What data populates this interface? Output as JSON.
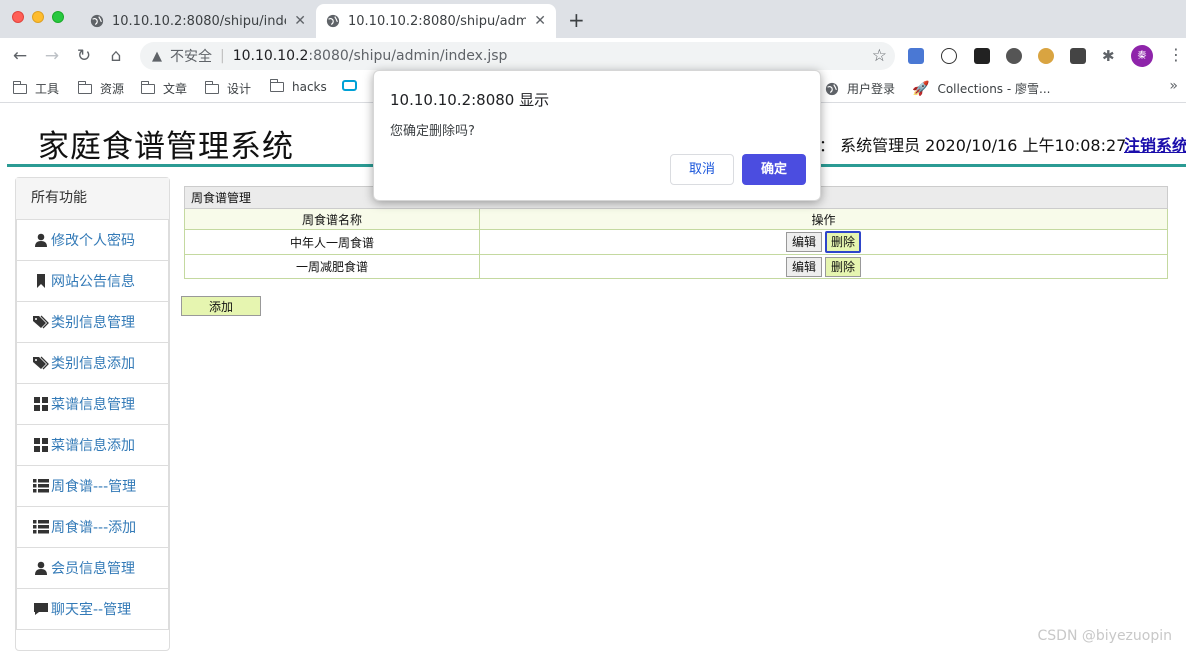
{
  "browser": {
    "tabs": [
      {
        "title": "10.10.10.2:8080/shipu/index#",
        "active": false
      },
      {
        "title": "10.10.10.2:8080/shipu/admin/in",
        "active": true
      }
    ],
    "address": {
      "security_label": "不安全",
      "host": "10.10.10.2",
      "path": ":8080/shipu/admin/index.jsp"
    },
    "profile_initial": "秦",
    "bookmarks": [
      {
        "label": "工具",
        "icon": "folder-icon"
      },
      {
        "label": "资源",
        "icon": "folder-icon"
      },
      {
        "label": "文章",
        "icon": "folder-icon"
      },
      {
        "label": "设计",
        "icon": "folder-icon"
      },
      {
        "label": "hacks",
        "icon": "folder-icon"
      },
      {
        "label": "用户登录",
        "icon": "globe-icon"
      },
      {
        "label": "Collections - 廖雪...",
        "icon": "rocket-icon"
      }
    ]
  },
  "header": {
    "site_title": "家庭食谱管理系统",
    "user_info": "：  系统管理员  2020/10/16 上午10:08:27",
    "logout_label": "注销系统"
  },
  "sidebar": {
    "heading": "所有功能",
    "items": [
      {
        "label": "修改个人密码",
        "icon": "user-icon"
      },
      {
        "label": "网站公告信息",
        "icon": "bookmark-icon"
      },
      {
        "label": "类别信息管理",
        "icon": "tags-icon"
      },
      {
        "label": "类别信息添加",
        "icon": "tags-icon"
      },
      {
        "label": "菜谱信息管理",
        "icon": "grid-icon"
      },
      {
        "label": "菜谱信息添加",
        "icon": "grid-icon"
      },
      {
        "label": "周食谱---管理",
        "icon": "list-icon"
      },
      {
        "label": "周食谱---添加",
        "icon": "list-icon"
      },
      {
        "label": "会员信息管理",
        "icon": "user-icon"
      },
      {
        "label": "聊天室--管理",
        "icon": "comment-icon"
      }
    ]
  },
  "table": {
    "caption": "周食谱管理",
    "headers": [
      "周食谱名称",
      "操作"
    ],
    "rows": [
      {
        "name": "中年人一周食谱",
        "edit": "编辑",
        "delete": "删除"
      },
      {
        "name": "一周减肥食谱",
        "edit": "编辑",
        "delete": "删除"
      }
    ],
    "add_label": "添加"
  },
  "dialog": {
    "title": "10.10.10.2:8080 显示",
    "message": "您确定删除吗?",
    "cancel_label": "取消",
    "ok_label": "确定"
  },
  "watermark": "CSDN @biyezuopin",
  "colors": {
    "header_line": "#2b9b94",
    "link": "#337ab7",
    "dialog_ok": "#4b4de0",
    "button_green": "#e6f5b0"
  }
}
